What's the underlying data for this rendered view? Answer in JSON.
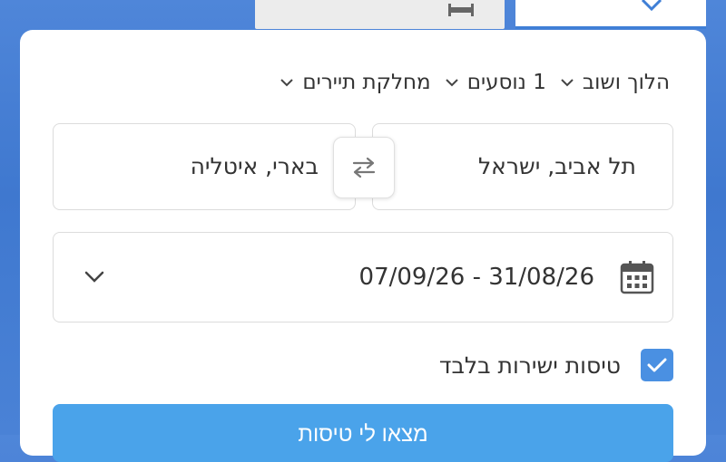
{
  "tabs": {
    "hotels_label": "",
    "flights_label": ""
  },
  "trip_type": "הלוך ושוב",
  "passengers": "1 נוסעים",
  "cabin_class": "מחלקת תיירים",
  "origin": "תל אביב, ישראל",
  "destination": "בארי, איטליה",
  "dates": "07/09/26 - 31/08/26",
  "direct_only": {
    "label": "טיסות ישירות בלבד",
    "checked": true
  },
  "search_button": "מצאו לי טיסות",
  "colors": {
    "accent": "#4a90e2",
    "search_button": "#4aa3ea",
    "background": "#4f86d9"
  },
  "icons": [
    "bed-icon",
    "plane-icon",
    "swap-icon",
    "calendar-icon",
    "chevron-down-icon",
    "checkmark-icon"
  ]
}
